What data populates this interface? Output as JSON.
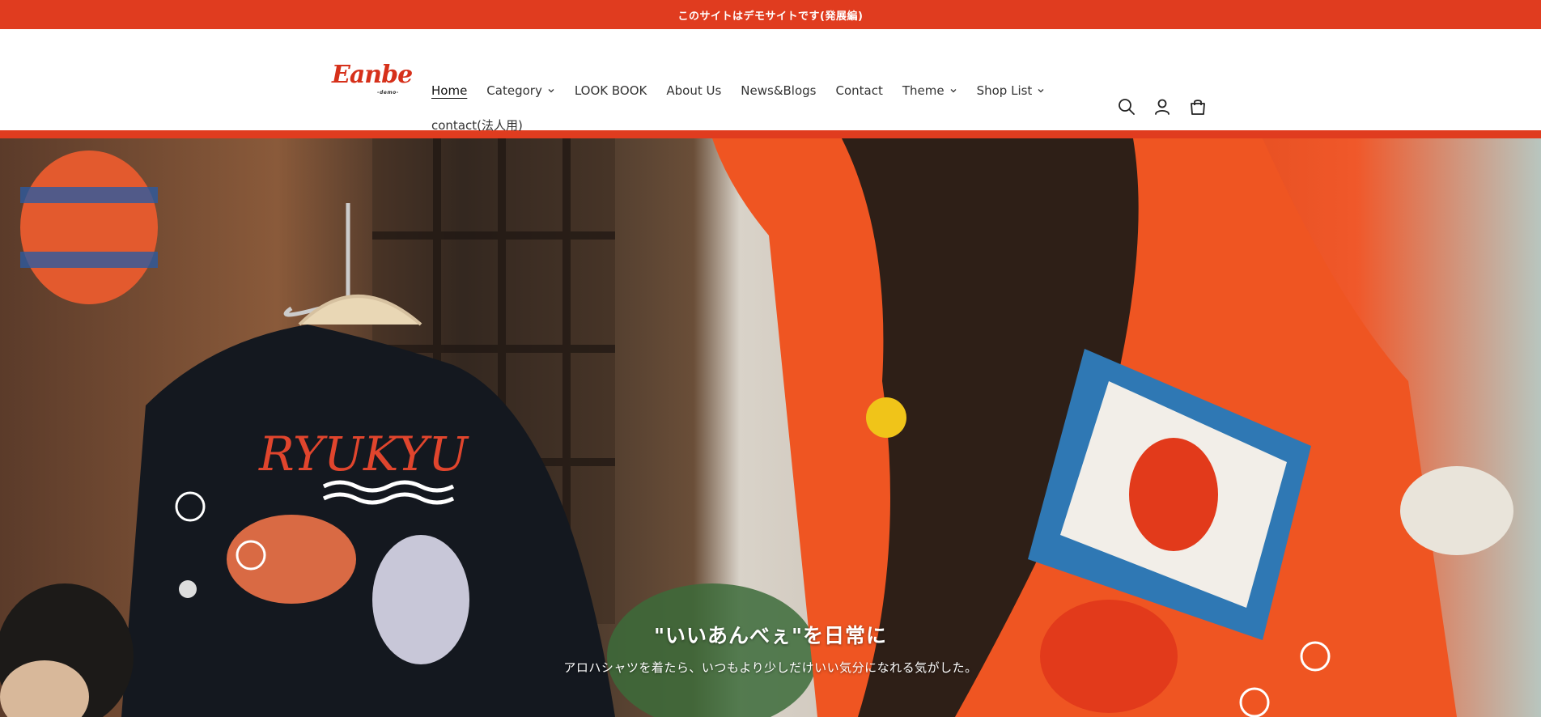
{
  "announcement": {
    "text": "このサイトはデモサイトです(発展編)"
  },
  "brand": {
    "logo_text": "Eanbe",
    "logo_sub": "-demo-"
  },
  "nav": {
    "row1": [
      {
        "label": "Home",
        "active": true,
        "dropdown": false
      },
      {
        "label": "Category",
        "active": false,
        "dropdown": true
      },
      {
        "label": "LOOK BOOK",
        "active": false,
        "dropdown": false
      },
      {
        "label": "About Us",
        "active": false,
        "dropdown": false
      },
      {
        "label": "News&Blogs",
        "active": false,
        "dropdown": false
      },
      {
        "label": "Contact",
        "active": false,
        "dropdown": false
      },
      {
        "label": "Theme",
        "active": false,
        "dropdown": true
      },
      {
        "label": "Shop List",
        "active": false,
        "dropdown": true
      }
    ],
    "row2": [
      {
        "label": "contact(法人用)",
        "active": false,
        "dropdown": false
      }
    ]
  },
  "header_icons": [
    "search-icon",
    "account-icon",
    "cart-icon"
  ],
  "hero": {
    "title": "\"いいあんべぇ\"を日常に",
    "subtitle": "アロハシャツを着たら、いつもより少しだけいい気分になれる気がした。"
  },
  "colors": {
    "accent": "#e03c1f",
    "logo": "#d6301a"
  }
}
